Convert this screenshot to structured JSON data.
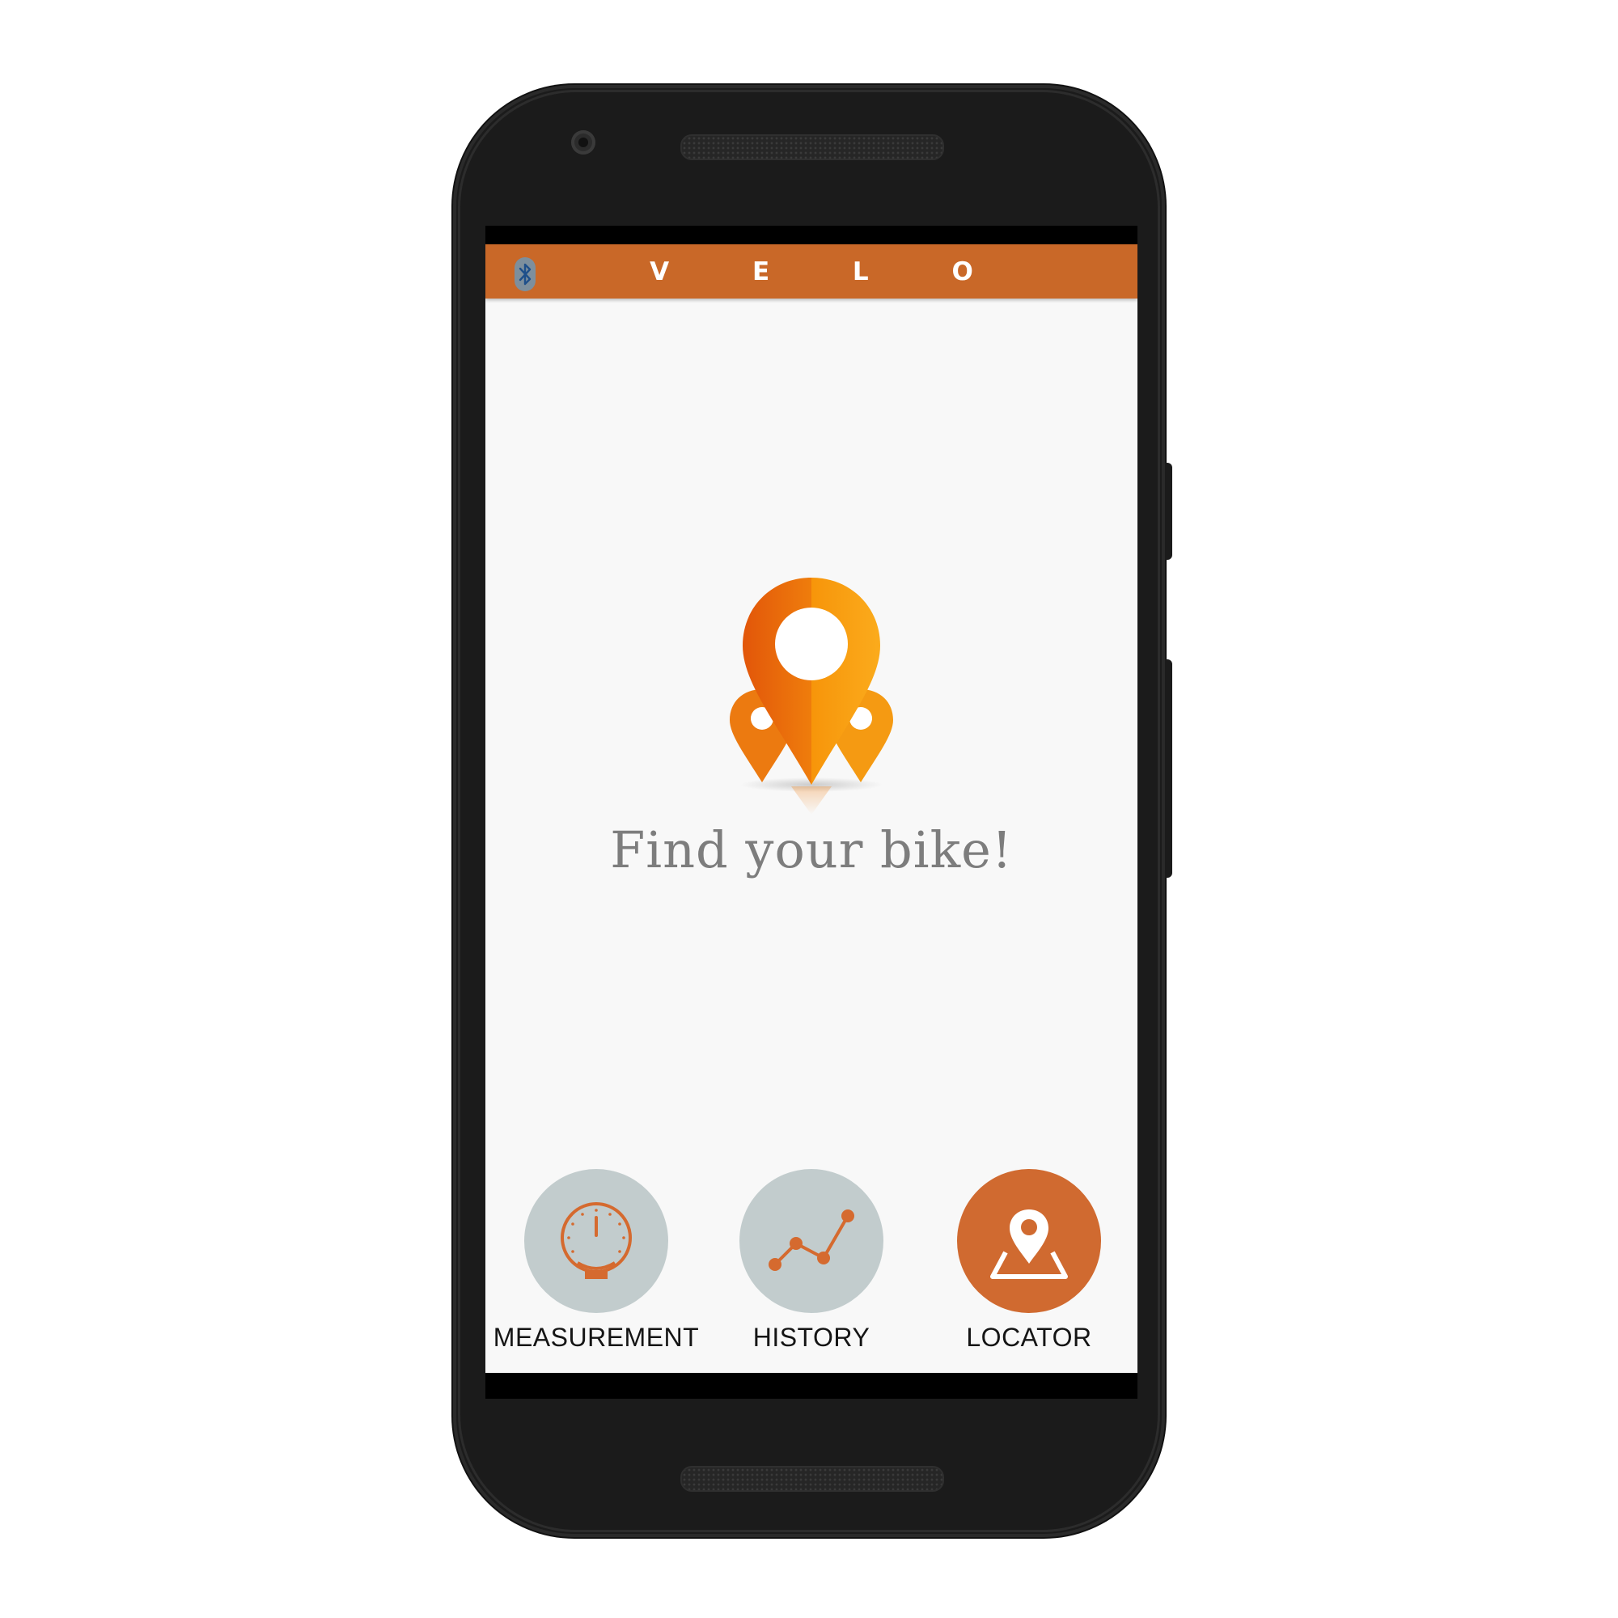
{
  "app": {
    "title": "V E L O",
    "accent_color": "#c96828",
    "bluetooth_icon": "bluetooth-icon"
  },
  "hero": {
    "icon": "location-pins-icon",
    "text": "Find your bike!"
  },
  "nav": {
    "items": [
      {
        "label": "MEASUREMENT",
        "icon": "stopwatch-icon",
        "active": false,
        "color": "#c2cccd"
      },
      {
        "label": "HISTORY",
        "icon": "line-graph-icon",
        "active": false,
        "color": "#c2cccd"
      },
      {
        "label": "LOCATOR",
        "icon": "map-pin-icon",
        "active": true,
        "color": "#d06a30"
      }
    ]
  }
}
